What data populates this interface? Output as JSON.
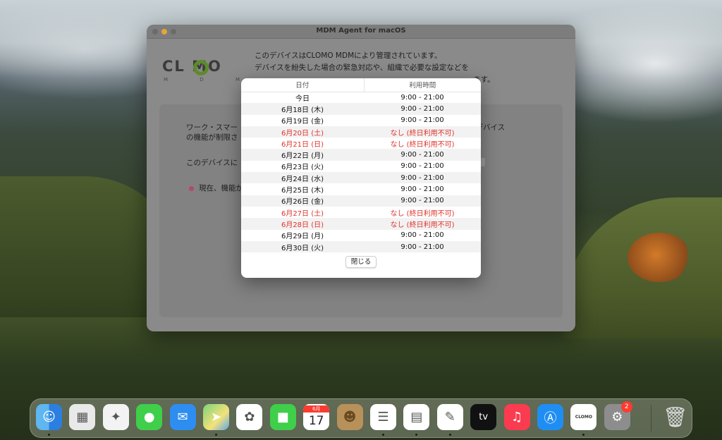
{
  "window": {
    "title": "MDM Agent for macOS"
  },
  "brand": {
    "text": "CL  MO",
    "sub": [
      "M",
      "D",
      "M"
    ]
  },
  "intro": {
    "line1": "このデバイスはCLOMO MDMにより管理されています。",
    "line2": "デバイスを紛失した場合の緊急対応や、組織で必要な設定などを",
    "line3": "ます。"
  },
  "panel": {
    "text1": "ワーク・スマー",
    "text1b": "ョンやデバイス",
    "text1c": "の機能が制限さ",
    "text2": "このデバイスに",
    "text3": "現在、機能が"
  },
  "schedule": {
    "header_date": "日付",
    "header_time": "利用時間",
    "rows": [
      {
        "date": "今日",
        "time": "9:00  -  21:00",
        "off": false
      },
      {
        "date": "6月18日 (木)",
        "time": "9:00  -  21:00",
        "off": false
      },
      {
        "date": "6月19日 (金)",
        "time": "9:00  -  21:00",
        "off": false
      },
      {
        "date": "6月20日 (土)",
        "time": "なし (終日利用不可)",
        "off": true
      },
      {
        "date": "6月21日 (日)",
        "time": "なし (終日利用不可)",
        "off": true
      },
      {
        "date": "6月22日 (月)",
        "time": "9:00  -  21:00",
        "off": false
      },
      {
        "date": "6月23日 (火)",
        "time": "9:00  -  21:00",
        "off": false
      },
      {
        "date": "6月24日 (水)",
        "time": "9:00  -  21:00",
        "off": false
      },
      {
        "date": "6月25日 (木)",
        "time": "9:00  -  21:00",
        "off": false
      },
      {
        "date": "6月26日 (金)",
        "time": "9:00  -  21:00",
        "off": false
      },
      {
        "date": "6月27日 (土)",
        "time": "なし (終日利用不可)",
        "off": true
      },
      {
        "date": "6月28日 (日)",
        "time": "なし (終日利用不可)",
        "off": true
      },
      {
        "date": "6月29日 (月)",
        "time": "9:00  -  21:00",
        "off": false
      },
      {
        "date": "6月30日 (火)",
        "time": "9:00  -  21:00",
        "off": false
      }
    ],
    "close_label": "閉じる"
  },
  "dock": {
    "calendar_month": "6月",
    "calendar_day": "17",
    "tv_label": "tv",
    "clomo_label": "CLOMO",
    "settings_badge": "2",
    "items": [
      {
        "name": "finder-icon",
        "glyph": "☺"
      },
      {
        "name": "launchpad-icon",
        "glyph": "▦"
      },
      {
        "name": "safari-icon",
        "glyph": "✦"
      },
      {
        "name": "messages-icon",
        "glyph": "●"
      },
      {
        "name": "mail-icon",
        "glyph": "✉"
      },
      {
        "name": "maps-icon",
        "glyph": "➤"
      },
      {
        "name": "photos-icon",
        "glyph": "✿"
      },
      {
        "name": "facetime-icon",
        "glyph": "■"
      },
      {
        "name": "calendar-icon",
        "glyph": ""
      },
      {
        "name": "contacts-icon",
        "glyph": "☻"
      },
      {
        "name": "reminders-icon",
        "glyph": "☰"
      },
      {
        "name": "notes-icon",
        "glyph": "▤"
      },
      {
        "name": "freeform-icon",
        "glyph": "✎"
      },
      {
        "name": "apple-tv-icon",
        "glyph": ""
      },
      {
        "name": "music-icon",
        "glyph": "♫"
      },
      {
        "name": "app-store-icon",
        "glyph": "Ⓐ"
      },
      {
        "name": "clomo-agent-icon",
        "glyph": ""
      },
      {
        "name": "system-settings-icon",
        "glyph": "⚙"
      },
      {
        "name": "trash-icon",
        "glyph": "🗑"
      }
    ]
  }
}
